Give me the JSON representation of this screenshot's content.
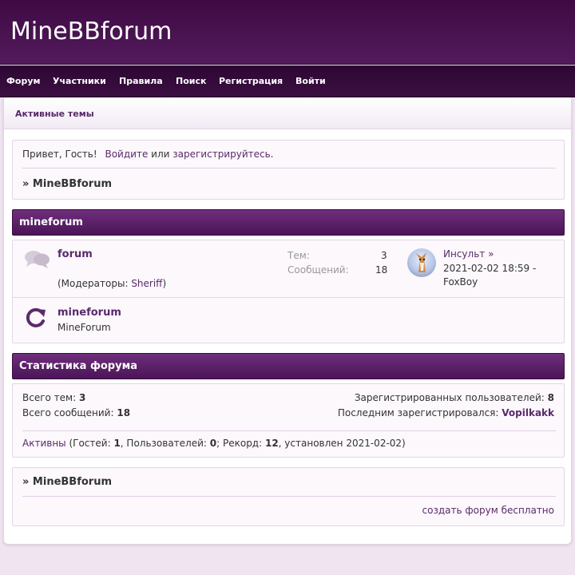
{
  "site": {
    "title": "MineBBforum"
  },
  "nav": {
    "items": [
      "Форум",
      "Участники",
      "Правила",
      "Поиск",
      "Регистрация",
      "Войти"
    ]
  },
  "subnav": {
    "active_topics": "Активные темы"
  },
  "welcome": {
    "greeting": "Привет, Гость!",
    "login": "Войдите",
    "or": "или",
    "register": "зарегистрируйтесь",
    "period": ".",
    "crumb": "» MineBBforum"
  },
  "category": {
    "title": "mineforum",
    "forums": [
      {
        "name": "forum",
        "moderators_prefix": "(Модераторы: ",
        "moderator": "Sheriff",
        "moderators_suffix": ")",
        "topics_label": "Тем:",
        "topics": "3",
        "posts_label": "Сообщений:",
        "posts": "18",
        "last_post_title": "Инсульт",
        "last_post_arrow": "»",
        "last_post_date": "2021-02-02 18:59 -",
        "last_post_user": "FoxBoy"
      },
      {
        "name": "mineforum",
        "description": "MineForum"
      }
    ]
  },
  "stats": {
    "title": "Статистика форума",
    "total_topics_label": "Всего тем:",
    "total_topics": "3",
    "total_posts_label": "Всего сообщений:",
    "total_posts": "18",
    "registered_label": "Зарегистрированных пользователей:",
    "registered": "8",
    "last_registered_label": "Последним зарегистрировался:",
    "last_registered": "Vopilkakk",
    "active_link": "Активны",
    "guests_label": " (Гостей: ",
    "guests": "1",
    "users_label": ", Пользователей: ",
    "users": "0",
    "record_label": "; Рекорд: ",
    "record": "12",
    "record_suffix": ", установлен 2021-02-02)"
  },
  "footer": {
    "crumb": "» MineBBforum",
    "create_link": "создать форум бесплатно"
  }
}
